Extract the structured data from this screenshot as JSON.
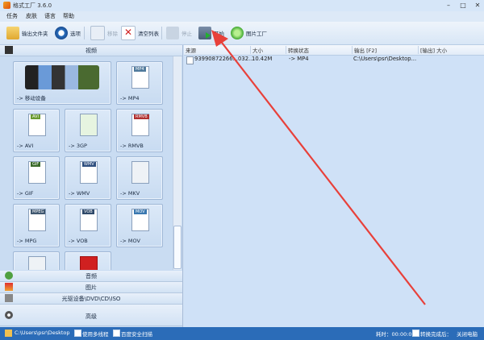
{
  "window": {
    "title": "格式工厂 3.6.0",
    "minimize": "–",
    "maximize": "□",
    "close": "✕"
  },
  "menu": [
    "任务",
    "皮肤",
    "语言",
    "帮助"
  ],
  "toolbar": {
    "output_folder": "输出文件夹",
    "options": "选项",
    "remove": "移除",
    "clear_list": "清空列表",
    "stop": "停止",
    "start": "开始",
    "picture_factory": "图片工厂"
  },
  "left": {
    "video_header": "视频",
    "tiles": [
      {
        "label": "-> 移动设备",
        "tag": ""
      },
      {
        "label": "-> MP4",
        "tag": "MP4"
      },
      {
        "label": "-> AVI",
        "tag": "AVI"
      },
      {
        "label": "-> 3GP",
        "tag": ""
      },
      {
        "label": "-> RMVB",
        "tag": "RMVB"
      },
      {
        "label": "-> GIF",
        "tag": "GIF"
      },
      {
        "label": "-> WMV",
        "tag": "WMV"
      },
      {
        "label": "-> MKV",
        "tag": ""
      },
      {
        "label": "-> MPG",
        "tag": "MPEG"
      },
      {
        "label": "-> VOB",
        "tag": "VOB"
      },
      {
        "label": "-> MOV",
        "tag": "MOV"
      }
    ],
    "audio_header": "音频",
    "picture_header": "图片",
    "disc_header": "光驱设备\\DVD\\CD\\ISO",
    "advanced_header": "高级"
  },
  "table": {
    "columns": [
      "来源",
      "大小",
      "转换状态",
      "输出 [F2]",
      "[输出] 大小"
    ],
    "rows": [
      {
        "source": "93990872266...032...",
        "size": "10.42M",
        "status": "-> MP4",
        "output": "C:\\Users\\psr\\Desktop...",
        "out_size": ""
      }
    ]
  },
  "status": {
    "path": "C:\\Users\\psr\\Desktop",
    "multithread": "使用多线程",
    "alert": "百度安全扫描",
    "elapsed": "耗时：00:00:00",
    "after_done": "转换完成后：",
    "shutdown": "关闭电脑"
  },
  "colors": {
    "accent": "#2b6cb8",
    "panel": "#cfe1f7",
    "arrow": "#e8403a"
  }
}
